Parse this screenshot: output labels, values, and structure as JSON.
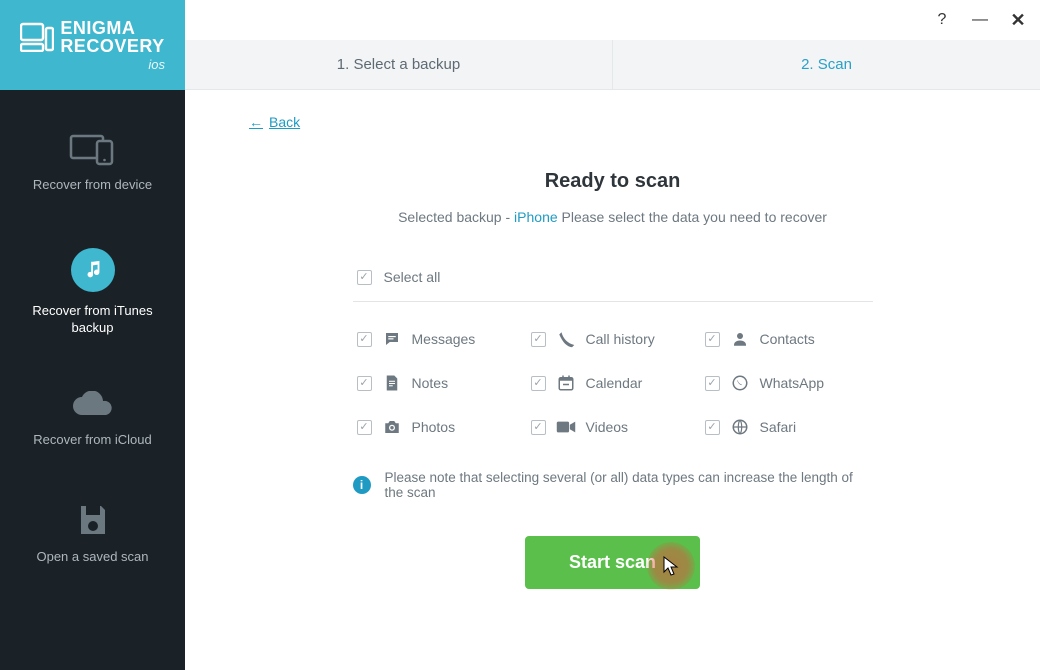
{
  "window": {
    "help": "?",
    "minimize": "—",
    "close": "✕"
  },
  "brand": {
    "line1": "ENIGMA",
    "line2": "RECOVERY",
    "sub": "ios"
  },
  "steps": [
    {
      "label": "1. Select a backup",
      "active": false
    },
    {
      "label": "2. Scan",
      "active": true
    }
  ],
  "sidebar": {
    "items": [
      {
        "label": "Recover from device"
      },
      {
        "label": "Recover from iTunes backup"
      },
      {
        "label": "Recover from iCloud"
      },
      {
        "label": "Open a saved scan"
      }
    ]
  },
  "main": {
    "back": "Back",
    "title": "Ready to scan",
    "sub_prefix": "Selected backup - ",
    "device": "iPhone",
    "sub_suffix": " Please select the data you need to recover",
    "select_all": "Select all",
    "types": [
      {
        "key": "messages",
        "label": "Messages"
      },
      {
        "key": "callhistory",
        "label": "Call history"
      },
      {
        "key": "contacts",
        "label": "Contacts"
      },
      {
        "key": "notes",
        "label": "Notes"
      },
      {
        "key": "calendar",
        "label": "Calendar"
      },
      {
        "key": "whatsapp",
        "label": "WhatsApp"
      },
      {
        "key": "photos",
        "label": "Photos"
      },
      {
        "key": "videos",
        "label": "Videos"
      },
      {
        "key": "safari",
        "label": "Safari"
      }
    ],
    "note": "Please note that selecting several (or all) data types can increase the length of the scan",
    "start": "Start scan"
  }
}
